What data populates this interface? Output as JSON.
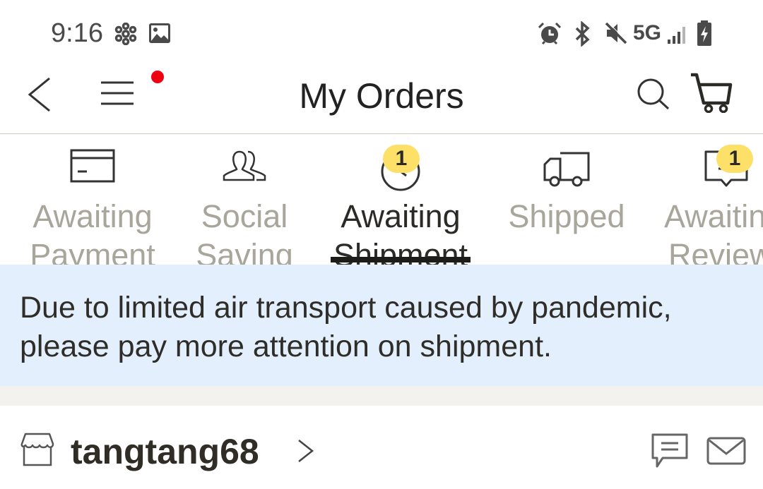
{
  "status_bar": {
    "time": "9:16",
    "left_icons": [
      "pinwheel-icon",
      "image-icon"
    ],
    "right_icons": [
      "alarm-icon",
      "bluetooth-icon",
      "mute-icon",
      "signal-icon",
      "battery-charging-icon"
    ],
    "network": "5G"
  },
  "header": {
    "title": "My Orders",
    "back_icon": "chevron-left-icon",
    "menu_icon": "hamburger-menu-icon",
    "menu_has_notification": true,
    "search_icon": "search-icon",
    "cart_icon": "cart-icon"
  },
  "tabs": [
    {
      "line1": "Awaiting",
      "line2": "Payment",
      "icon": "credit-card-icon",
      "badge": null,
      "active": false
    },
    {
      "line1": "Social",
      "line2": "Saving",
      "icon": "people-icon",
      "badge": null,
      "active": false
    },
    {
      "line1": "Awaiting",
      "line2": "Shipment",
      "icon": "clock-icon",
      "badge": "1",
      "active": true
    },
    {
      "line1": "Shipped",
      "line2": "",
      "icon": "truck-icon",
      "badge": null,
      "active": false
    },
    {
      "line1": "Awaiting",
      "line2": "Review",
      "icon": "review-icon",
      "badge": "1",
      "active": false
    }
  ],
  "notice": {
    "text": "Due to limited air transport caused by pandemic, please pay more attention on shipment."
  },
  "store": {
    "name": "tangtang68",
    "icons": [
      "store-icon",
      "chevron-right-icon",
      "chat-icon",
      "mail-icon"
    ]
  },
  "colors": {
    "badge": "#fde068",
    "notice_bg": "#e3effd",
    "notification_dot": "#ee0010",
    "inactive_tab": "#a8a59b"
  }
}
